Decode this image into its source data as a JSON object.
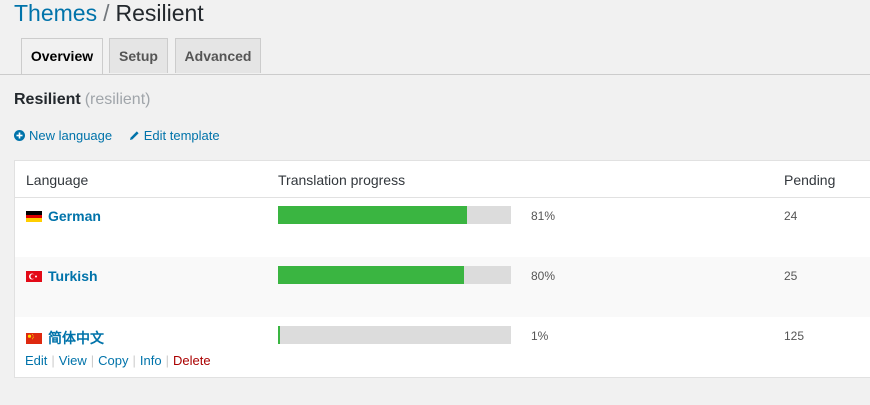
{
  "breadcrumb": {
    "parent": "Themes",
    "separator": "/",
    "current": "Resilient"
  },
  "tabs": [
    {
      "label": "Overview",
      "active": true
    },
    {
      "label": "Setup",
      "active": false
    },
    {
      "label": "Advanced",
      "active": false
    }
  ],
  "package": {
    "name": "Resilient",
    "slug": "(resilient)"
  },
  "actions": {
    "new_language": "New language",
    "edit_template": "Edit template"
  },
  "table": {
    "headers": {
      "language": "Language",
      "progress": "Translation progress",
      "pending": "Pending"
    },
    "rows": [
      {
        "flag": "de",
        "name": "German",
        "progress": 81,
        "progress_label": "81%",
        "pending": "24"
      },
      {
        "flag": "tr",
        "name": "Turkish",
        "progress": 80,
        "progress_label": "80%",
        "pending": "25"
      },
      {
        "flag": "cn",
        "name": "简体中文",
        "progress": 1,
        "progress_label": "1%",
        "pending": "125"
      }
    ],
    "row_actions": [
      "Edit",
      "View",
      "Copy",
      "Info",
      "Delete"
    ]
  },
  "colors": {
    "link": "#0073aa",
    "progress_fill": "#3ab541",
    "progress_track": "#dcdcdc",
    "delete": "#aa0000"
  }
}
